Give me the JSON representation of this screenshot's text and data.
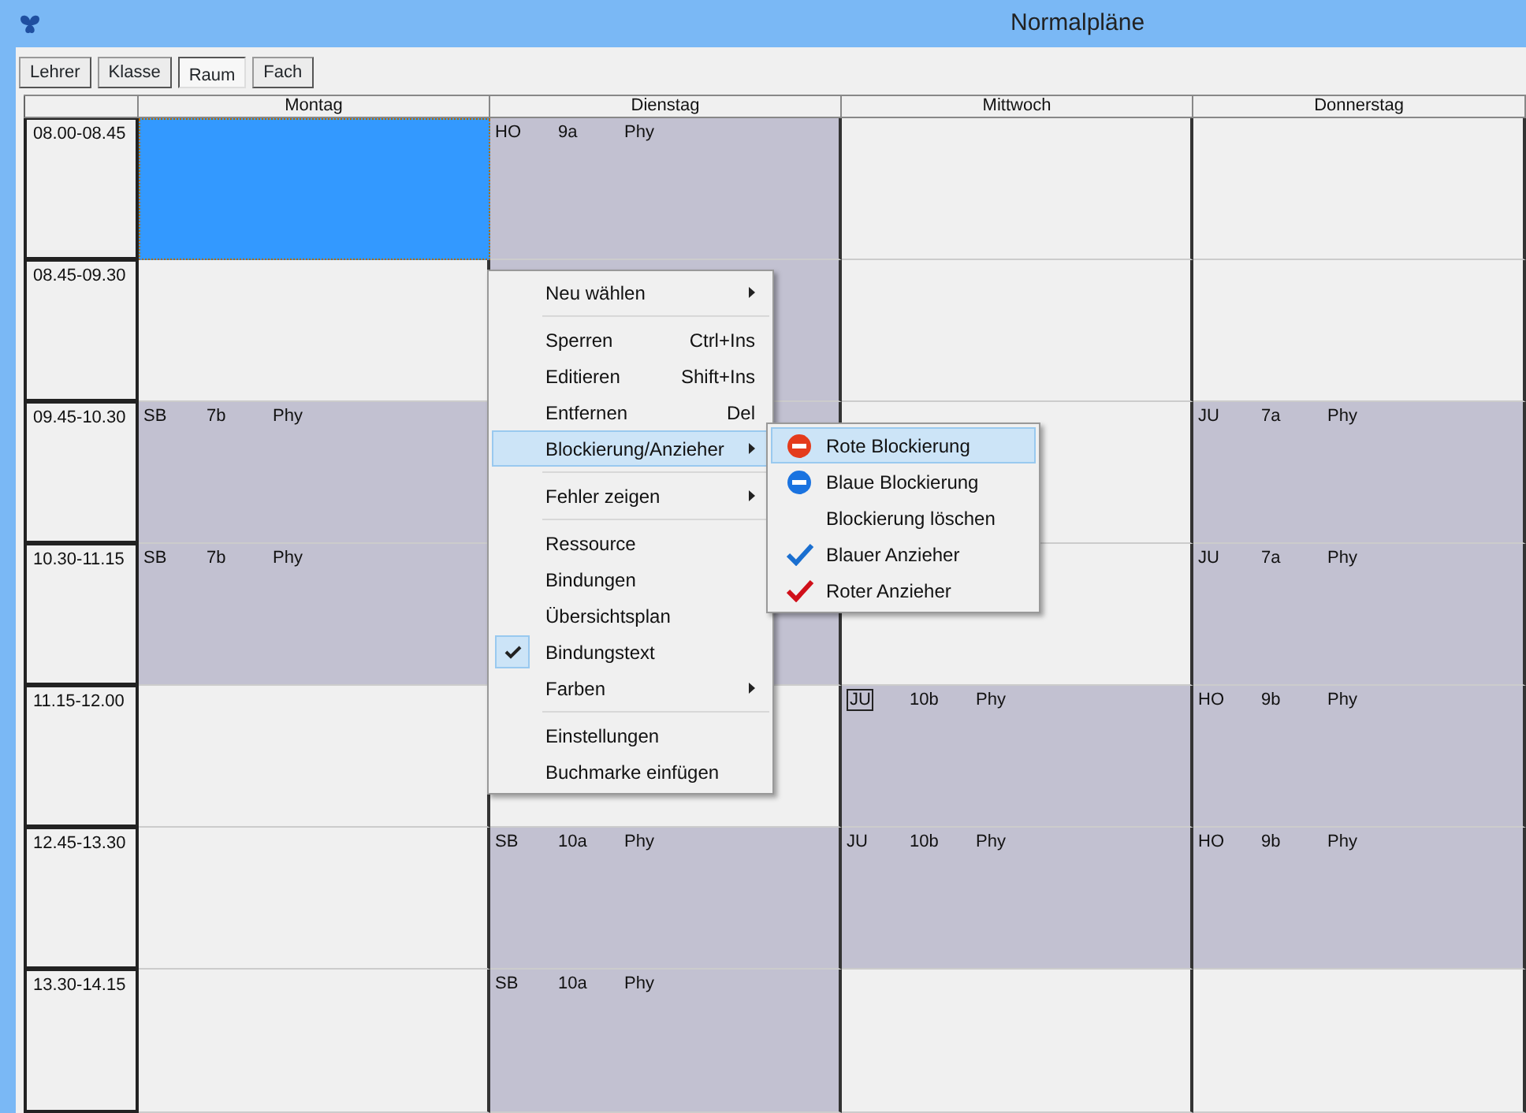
{
  "window": {
    "title": "Normalpläne"
  },
  "toolbar": [
    {
      "label": "Lehrer",
      "selected": false
    },
    {
      "label": "Klasse",
      "selected": false
    },
    {
      "label": "Raum",
      "selected": true
    },
    {
      "label": "Fach",
      "selected": false
    }
  ],
  "days": [
    "Montag",
    "Dienstag",
    "Mittwoch",
    "Donnerstag"
  ],
  "rows": [
    {
      "time": "08.00-08.45",
      "cells": [
        {
          "kind": "selected"
        },
        {
          "kind": "busy",
          "teacher": "HO",
          "class": "9a",
          "subject": "Phy"
        },
        {
          "kind": "free"
        },
        {
          "kind": "free"
        }
      ]
    },
    {
      "time": "08.45-09.30",
      "cells": [
        {
          "kind": "free"
        },
        {
          "kind": "busy"
        },
        {
          "kind": "free"
        },
        {
          "kind": "free"
        }
      ]
    },
    {
      "time": "09.45-10.30",
      "cells": [
        {
          "kind": "busy",
          "teacher": "SB",
          "class": "7b",
          "subject": "Phy"
        },
        {
          "kind": "busy"
        },
        {
          "kind": "free"
        },
        {
          "kind": "busy",
          "teacher": "JU",
          "class": "7a",
          "subject": "Phy"
        }
      ]
    },
    {
      "time": "10.30-11.15",
      "cells": [
        {
          "kind": "busy",
          "teacher": "SB",
          "class": "7b",
          "subject": "Phy"
        },
        {
          "kind": "busy"
        },
        {
          "kind": "free"
        },
        {
          "kind": "busy",
          "teacher": "JU",
          "class": "7a",
          "subject": "Phy"
        }
      ]
    },
    {
      "time": "11.15-12.00",
      "cells": [
        {
          "kind": "free"
        },
        {
          "kind": "free"
        },
        {
          "kind": "busy",
          "teacher": "JU",
          "class": "10b",
          "subject": "Phy",
          "framed": true
        },
        {
          "kind": "busy",
          "teacher": "HO",
          "class": "9b",
          "subject": "Phy"
        }
      ]
    },
    {
      "time": "12.45-13.30",
      "cells": [
        {
          "kind": "free"
        },
        {
          "kind": "busy",
          "teacher": "SB",
          "class": "10a",
          "subject": "Phy"
        },
        {
          "kind": "busy",
          "teacher": "JU",
          "class": "10b",
          "subject": "Phy"
        },
        {
          "kind": "busy",
          "teacher": "HO",
          "class": "9b",
          "subject": "Phy"
        }
      ]
    },
    {
      "time": "13.30-14.15",
      "cells": [
        {
          "kind": "free"
        },
        {
          "kind": "busy",
          "teacher": "SB",
          "class": "10a",
          "subject": "Phy"
        },
        {
          "kind": "free"
        },
        {
          "kind": "free"
        }
      ]
    }
  ],
  "context_menu": [
    {
      "kind": "item",
      "label": "Neu wählen",
      "submenu": true,
      "selected": false,
      "checked": false
    },
    {
      "kind": "separator"
    },
    {
      "kind": "item",
      "label": "Sperren",
      "shortcut": "Ctrl+Ins",
      "submenu": false,
      "selected": false,
      "checked": false
    },
    {
      "kind": "item",
      "label": "Editieren",
      "shortcut": "Shift+Ins",
      "submenu": false,
      "selected": false,
      "checked": false
    },
    {
      "kind": "item",
      "label": "Entfernen",
      "shortcut": "Del",
      "submenu": false,
      "selected": false,
      "checked": false
    },
    {
      "kind": "item",
      "label": "Blockierung/Anzieher",
      "submenu": true,
      "selected": true,
      "checked": false
    },
    {
      "kind": "separator"
    },
    {
      "kind": "item",
      "label": "Fehler zeigen",
      "submenu": true,
      "selected": false,
      "checked": false
    },
    {
      "kind": "separator"
    },
    {
      "kind": "item",
      "label": "Ressource",
      "submenu": false,
      "selected": false,
      "checked": false
    },
    {
      "kind": "item",
      "label": "Bindungen",
      "submenu": false,
      "selected": false,
      "checked": false
    },
    {
      "kind": "item",
      "label": "Übersichtsplan",
      "submenu": false,
      "selected": false,
      "checked": false
    },
    {
      "kind": "item",
      "label": "Bindungstext",
      "submenu": false,
      "selected": false,
      "checked": true
    },
    {
      "kind": "item",
      "label": "Farben",
      "submenu": true,
      "selected": false,
      "checked": false
    },
    {
      "kind": "separator"
    },
    {
      "kind": "item",
      "label": "Einstellungen",
      "submenu": false,
      "selected": false,
      "checked": false
    },
    {
      "kind": "item",
      "label": "Buchmarke einfügen",
      "submenu": false,
      "selected": false,
      "checked": false
    }
  ],
  "submenu": [
    {
      "label": "Rote Blockierung",
      "kind": "block",
      "color": "#e43b1c",
      "selected": true
    },
    {
      "label": "Blaue Blockierung",
      "kind": "block",
      "color": "#1a73e0",
      "selected": false
    },
    {
      "label": "Blockierung löschen",
      "kind": "plain",
      "selected": false
    },
    {
      "label": "Blauer Anzieher",
      "kind": "check",
      "color": "#1a6fd0",
      "selected": false
    },
    {
      "label": "Roter Anzieher",
      "kind": "check",
      "color": "#d0101a",
      "selected": false
    }
  ]
}
